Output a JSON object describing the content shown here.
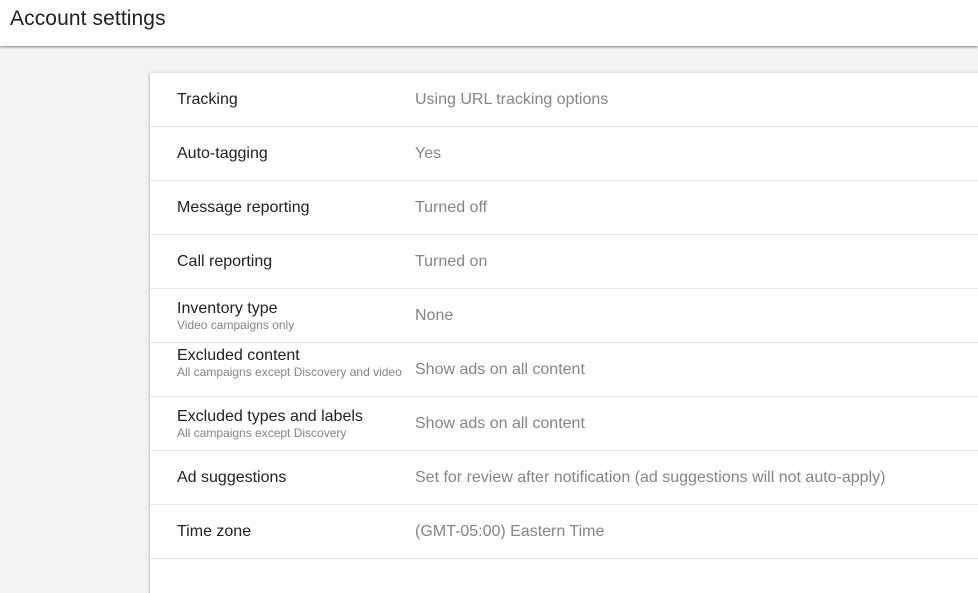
{
  "header": {
    "title": "Account settings"
  },
  "settings": [
    {
      "name": "Tracking",
      "subtitle": "",
      "value": "Using URL tracking options"
    },
    {
      "name": "Auto-tagging",
      "subtitle": "",
      "value": "Yes"
    },
    {
      "name": "Message reporting",
      "subtitle": "",
      "value": "Turned off"
    },
    {
      "name": "Call reporting",
      "subtitle": "",
      "value": "Turned on"
    },
    {
      "name": "Inventory type",
      "subtitle": "Video campaigns only",
      "value": "None"
    },
    {
      "name": "Excluded content",
      "subtitle": "All campaigns except Discovery and video",
      "value": "Show ads on all content"
    },
    {
      "name": "Excluded types and labels",
      "subtitle": "All campaigns except Discovery",
      "value": "Show ads on all content"
    },
    {
      "name": "Ad suggestions",
      "subtitle": "",
      "value": "Set for review after notification (ad suggestions will not auto-apply)"
    },
    {
      "name": "Time zone",
      "subtitle": "",
      "value": "(GMT-05:00) Eastern Time"
    }
  ]
}
